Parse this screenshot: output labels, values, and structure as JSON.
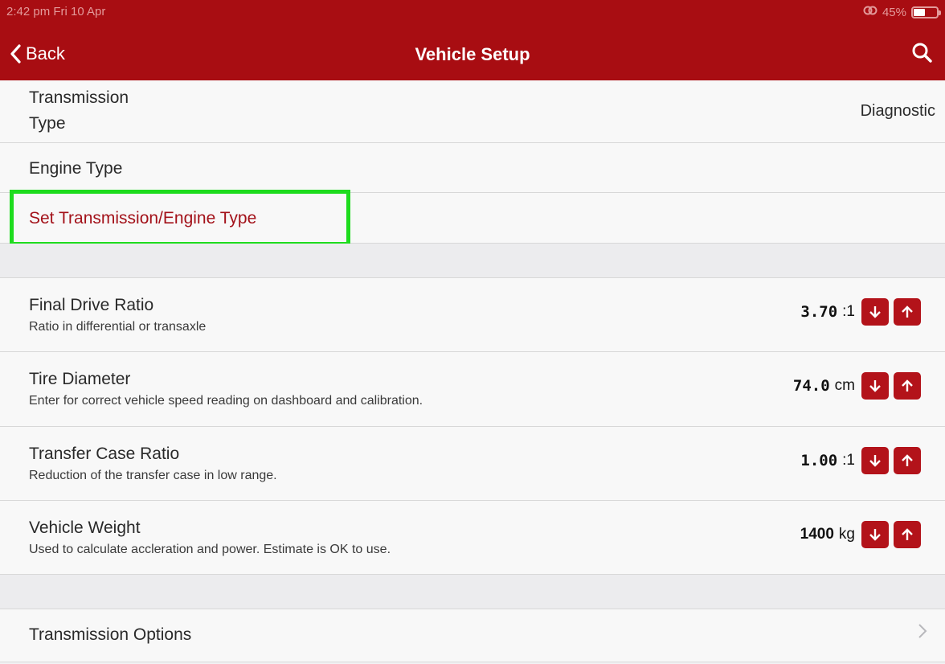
{
  "status": {
    "time": "2:42 pm  Fri 10 Apr",
    "battery": "45%"
  },
  "nav": {
    "back_label": "Back",
    "title": "Vehicle Setup"
  },
  "rows": {
    "transmission_type": {
      "title_line1": "Transmission",
      "title_line2": "Type",
      "value": "Diagnostic"
    },
    "engine_type": {
      "title": "Engine Type"
    },
    "set_type": {
      "label": "Set Transmission/Engine Type"
    }
  },
  "settings": [
    {
      "title": "Final Drive Ratio",
      "subtitle": "Ratio in differential or transaxle",
      "value": "3.70",
      "unit": ":1"
    },
    {
      "title": "Tire Diameter",
      "subtitle": "Enter for correct vehicle speed reading on dashboard and calibration.",
      "value": "74.0",
      "unit": "cm"
    },
    {
      "title": "Transfer Case Ratio",
      "subtitle": "Reduction of the transfer case in low range.",
      "value": "1.00",
      "unit": ":1"
    },
    {
      "title": "Vehicle Weight",
      "subtitle": "Used to calculate accleration and power. Estimate is OK to use.",
      "value": "1400",
      "unit": "kg"
    }
  ],
  "transmission_options": {
    "label": "Transmission Options"
  },
  "colors": {
    "accent": "#a80d12",
    "highlight": "#1edc1e"
  }
}
